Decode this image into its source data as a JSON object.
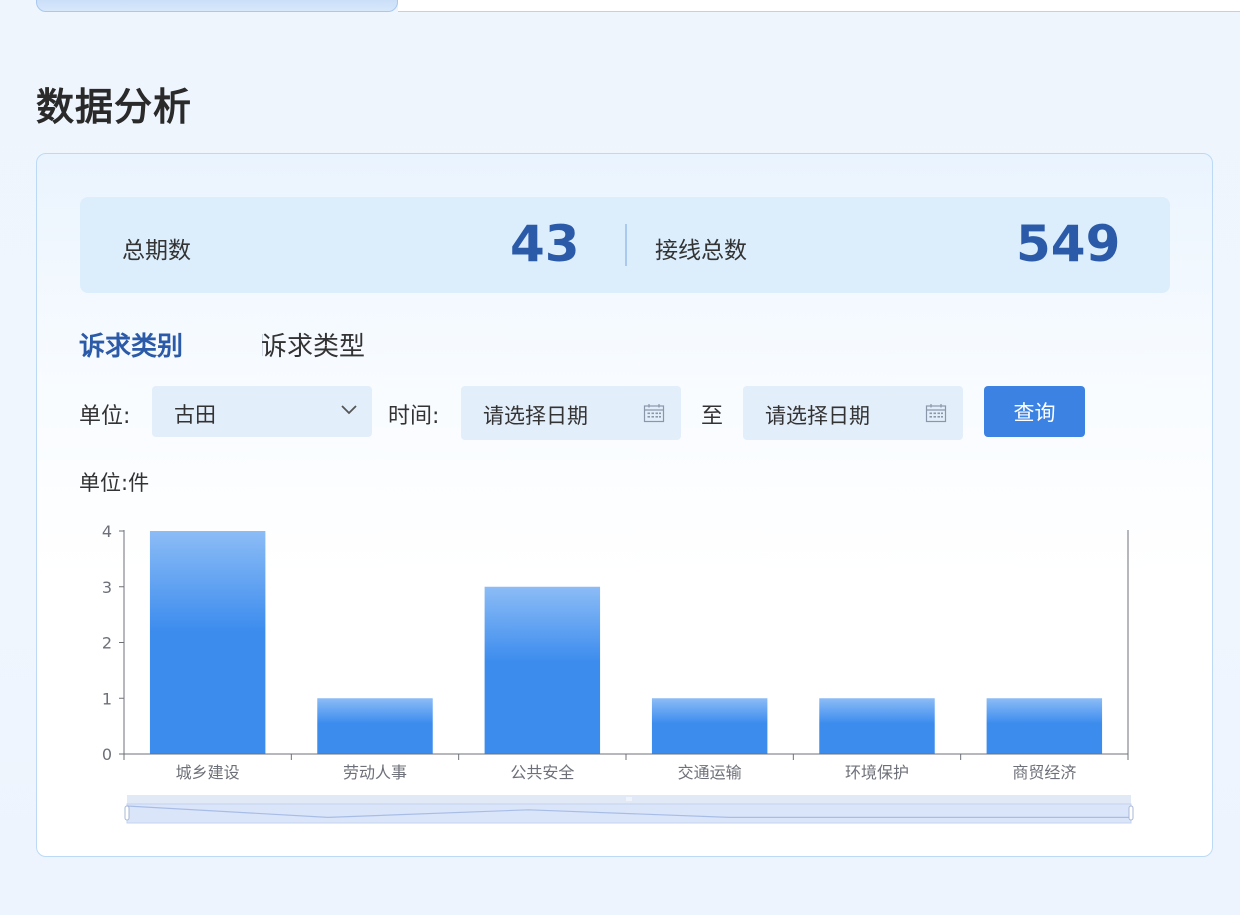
{
  "page": {
    "title": "数据分析"
  },
  "stats": [
    {
      "label": "总期数",
      "value": "43"
    },
    {
      "label": "接线总数",
      "value": "549"
    }
  ],
  "tabs": [
    {
      "label": "诉求类别",
      "active": true
    },
    {
      "label": "诉求类型",
      "active": false
    }
  ],
  "filters": {
    "unit_label": "单位:",
    "unit_value": "古田",
    "time_label": "时间:",
    "start_placeholder": "请选择日期",
    "to_label": "至",
    "end_placeholder": "请选择日期",
    "query_label": "查询"
  },
  "chart_unit_label": "单位:件",
  "colors": {
    "accent": "#2b5aa8",
    "button": "#3c82e3",
    "bar_top": "#8cbcf6",
    "bar_bottom": "#3c8cee"
  },
  "icons": {
    "dropdown": "chevron-down-icon",
    "date": "calendar-icon"
  },
  "chart_data": {
    "type": "bar",
    "categories": [
      "城乡建设",
      "劳动人事",
      "公共安全",
      "交通运输",
      "环境保护",
      "商贸经济"
    ],
    "values": [
      4,
      1,
      3,
      1,
      1,
      1
    ],
    "ylim": [
      0,
      4
    ],
    "yticks": [
      0,
      1,
      2,
      3,
      4
    ],
    "grid": false,
    "datazoom": true
  }
}
